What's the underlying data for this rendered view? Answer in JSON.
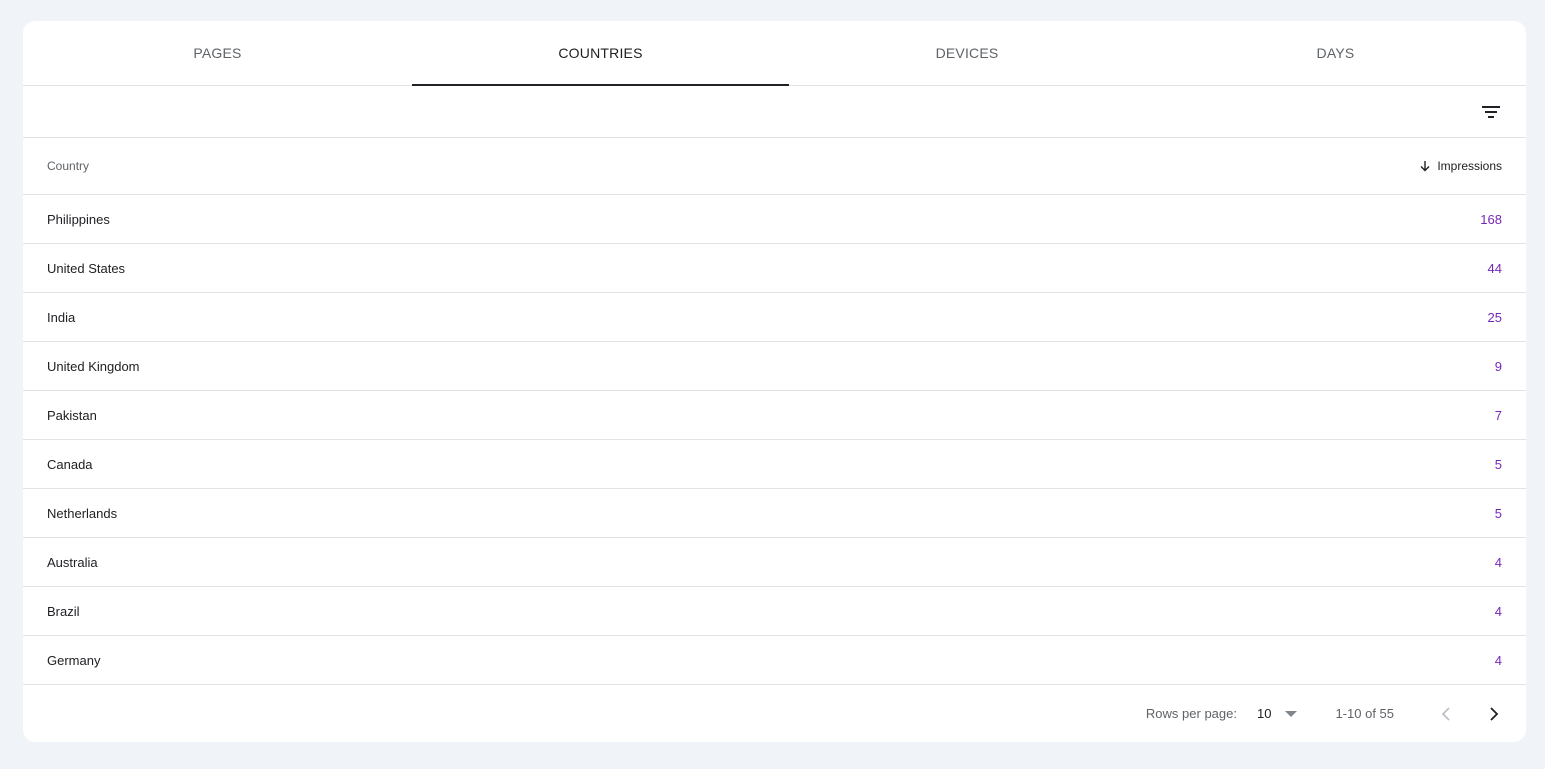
{
  "tabs": [
    {
      "label": "PAGES",
      "active": false
    },
    {
      "label": "COUNTRIES",
      "active": true
    },
    {
      "label": "DEVICES",
      "active": false
    },
    {
      "label": "DAYS",
      "active": false
    }
  ],
  "filter": {
    "icon": "filter-icon"
  },
  "table": {
    "columns": {
      "country": "Country",
      "impressions": "Impressions",
      "sort_icon": "arrow-down-icon"
    },
    "rows": [
      {
        "country": "Philippines",
        "impressions": "168"
      },
      {
        "country": "United States",
        "impressions": "44"
      },
      {
        "country": "India",
        "impressions": "25"
      },
      {
        "country": "United Kingdom",
        "impressions": "9"
      },
      {
        "country": "Pakistan",
        "impressions": "7"
      },
      {
        "country": "Canada",
        "impressions": "5"
      },
      {
        "country": "Netherlands",
        "impressions": "5"
      },
      {
        "country": "Australia",
        "impressions": "4"
      },
      {
        "country": "Brazil",
        "impressions": "4"
      },
      {
        "country": "Germany",
        "impressions": "4"
      }
    ]
  },
  "pagination": {
    "rows_per_page_label": "Rows per page:",
    "rows_per_page_value": "10",
    "range": "1-10 of 55"
  },
  "colors": {
    "background": "#f0f3f8",
    "value": "#7627bb",
    "active_tab": "#202124"
  }
}
